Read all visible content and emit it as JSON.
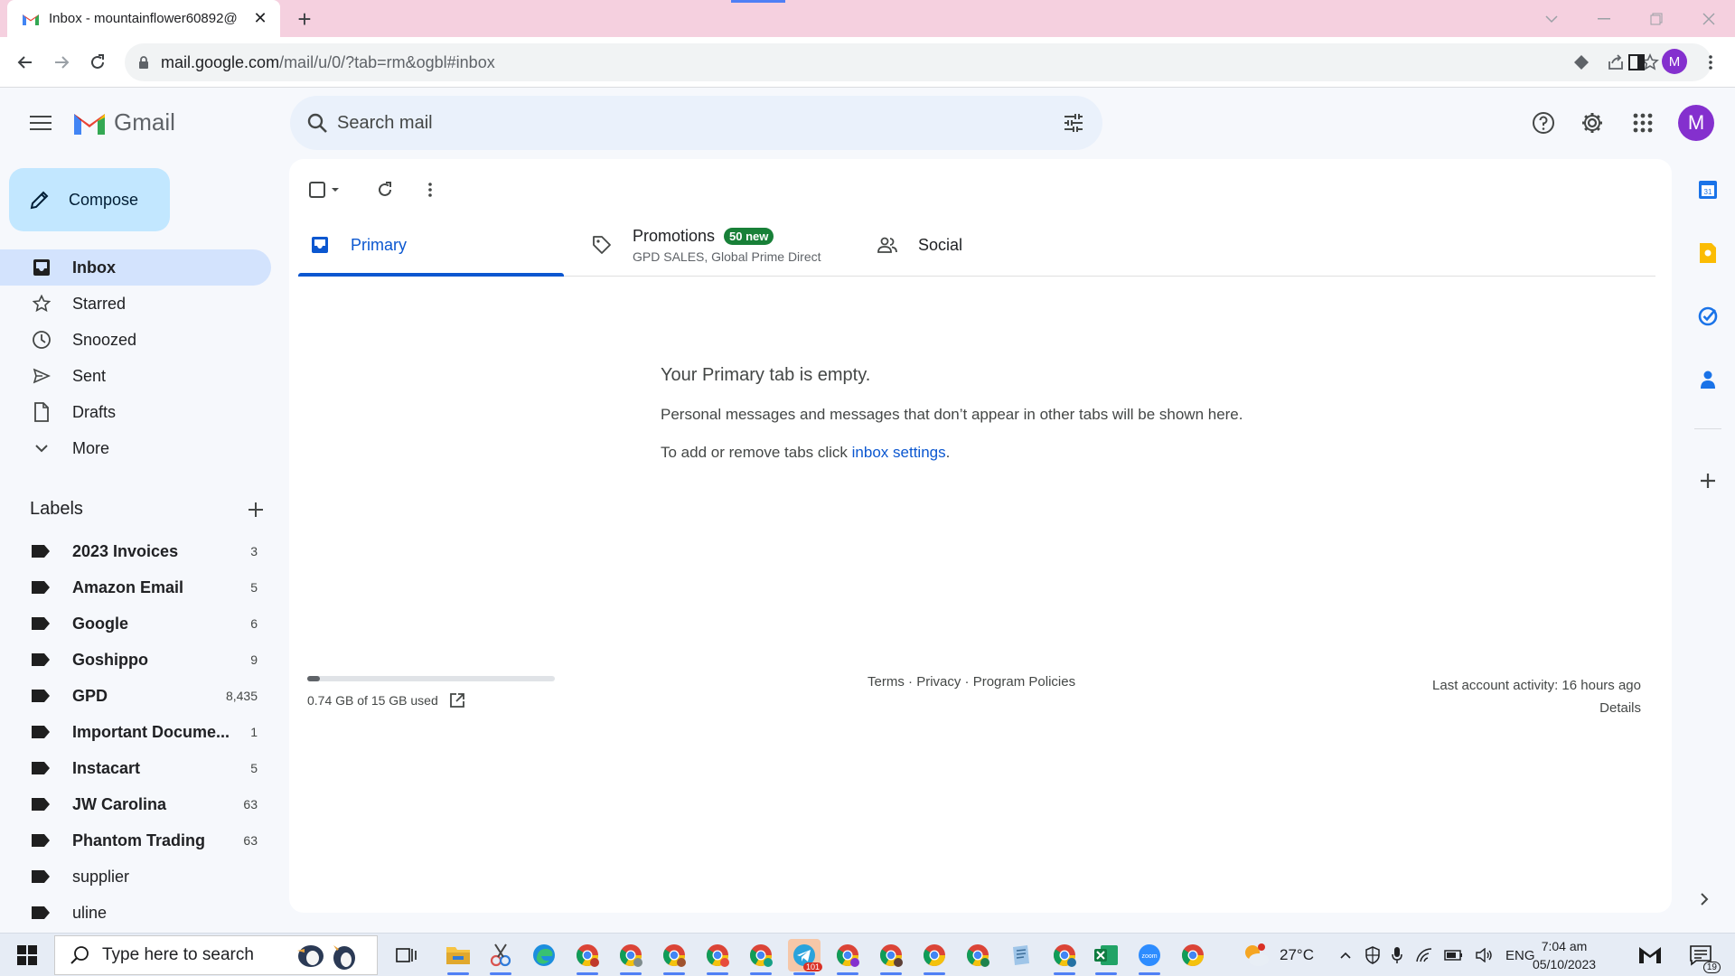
{
  "browser": {
    "tab_title": "Inbox - mountainflower60892@",
    "url_host": "mail.google.com",
    "url_path": "/mail/u/0/?tab=rm&ogbl#inbox",
    "profile_initial": "M"
  },
  "gmail": {
    "logo_text": "Gmail",
    "search_placeholder": "Search mail",
    "avatar_initial": "M",
    "compose_label": "Compose"
  },
  "nav": {
    "items": [
      {
        "label": "Inbox",
        "icon": "inbox-icon"
      },
      {
        "label": "Starred",
        "icon": "star-icon"
      },
      {
        "label": "Snoozed",
        "icon": "clock-icon"
      },
      {
        "label": "Sent",
        "icon": "send-icon"
      },
      {
        "label": "Drafts",
        "icon": "draft-icon"
      },
      {
        "label": "More",
        "icon": "chevron-down-icon"
      }
    ],
    "labels_title": "Labels",
    "labels": [
      {
        "name": "2023 Invoices",
        "count": "3"
      },
      {
        "name": "Amazon Email",
        "count": "5"
      },
      {
        "name": "Google",
        "count": "6"
      },
      {
        "name": "Goshippo",
        "count": "9"
      },
      {
        "name": "GPD",
        "count": "8,435"
      },
      {
        "name": "Important Docume...",
        "count": "1"
      },
      {
        "name": "Instacart",
        "count": "5"
      },
      {
        "name": "JW Carolina",
        "count": "63"
      },
      {
        "name": "Phantom Trading",
        "count": "63"
      },
      {
        "name": "supplier",
        "count": ""
      },
      {
        "name": "uline",
        "count": ""
      }
    ]
  },
  "tabs": {
    "primary": "Primary",
    "promotions": "Promotions",
    "promotions_badge": "50 new",
    "promotions_senders": "GPD SALES, Global Prime Direct",
    "social": "Social"
  },
  "empty_state": {
    "title": "Your Primary tab is empty.",
    "body": "Personal messages and messages that don’t appear in other tabs will be shown here.",
    "tabs_prefix": "To add or remove tabs click ",
    "tabs_link": "inbox settings",
    "tabs_suffix": "."
  },
  "footer": {
    "storage_text": "0.74 GB of 15 GB used",
    "storage_fraction": 0.05,
    "terms": "Terms",
    "privacy": "Privacy",
    "program_policies": "Program Policies",
    "separator": " · ",
    "last_activity": "Last account activity: 16 hours ago",
    "details": "Details"
  },
  "taskbar": {
    "search_placeholder": "Type here to search",
    "weather": "27°C",
    "language": "ENG",
    "time": "7:04 am",
    "date": "05/10/2023",
    "notification_count": "19",
    "telegram_badge": "101"
  },
  "colors": {
    "accent": "#0b57d0",
    "compose_bg": "#c2e7ff",
    "active_nav": "#d3e3fd",
    "badge_green": "#188038",
    "avatar": "#8430ce"
  }
}
